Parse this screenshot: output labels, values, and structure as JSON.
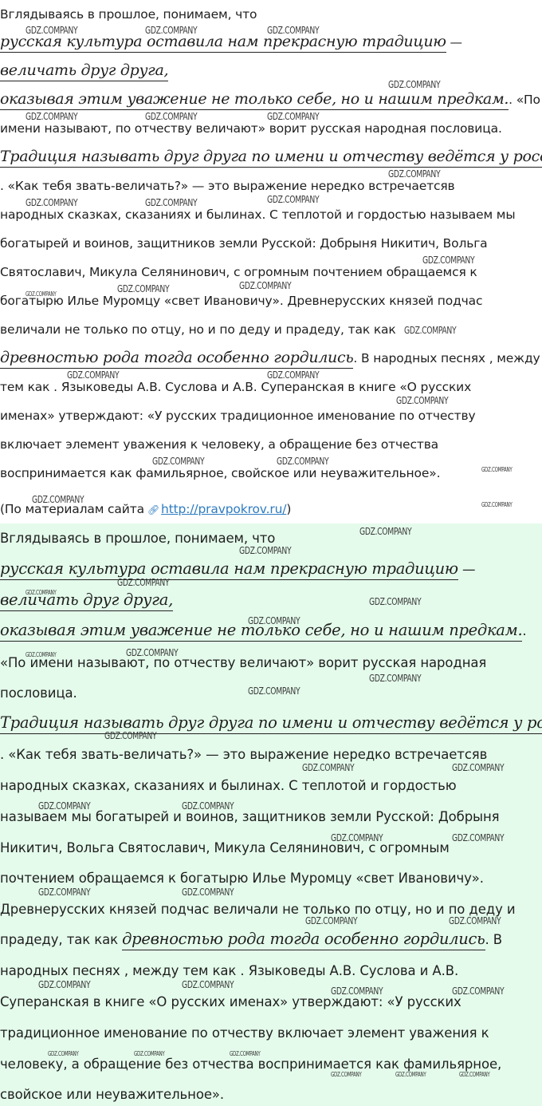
{
  "watermark": "GDZ.COMPANY",
  "link_icon": "link-icon",
  "top": {
    "l1": "Вглядываясь в прошлое, понимаем, что",
    "l2_hl": "русская культура оставила нам прекрасную традицию",
    "l2_tail": " —",
    "l3_hl": "величать друг друга,",
    "l4_hl": "оказывая этим уважение не только себе,  но и нашим предкам.",
    "l4_tail": ". «По",
    "l5": "имени называют, по отчеству величают» ворит русская народная пословица.",
    "l6_hl": "Традиция называть друг друга по имени и отчеству ведётся у россиян и",
    "l7": ". «Как тебя звать-величать?» — это выражение нередко встречаетсяв",
    "l8": "народных сказках, сказаниях и былинах. С теплотой и гордостью называем мы",
    "l9": "богатырей и воинов, защитников земли Русской: Добрыня Никитич, Вольга",
    "l10": "Святославич, Микула Селянинович, с огромным почтением обращаемся к",
    "l11": "богатырю Илье Муромцу «свет Ивановичу». Древнерусских князей подчас",
    "l12": "величали не только по отцу, но и по деду и прадеду, так как",
    "l13_hl": "древностью рода тогда особенно гордились",
    "l13_tail": ". В народных песнях , между",
    "l14": "тем как . Языковеды А.В. Суслова и А.В. Суперанская в книге «О русских",
    "l15": "именах» утверждают: «У русских традиционное именование по отчеству",
    "l16": "включает элемент уважения к человеку, а обращение без отчества",
    "l17": "воспринимается как фамильярное, свойское или неуважительное».",
    "src_prefix": "(По материалам сайта",
    "src_link": "http://pravpokrov.ru/",
    "src_suffix": ")"
  },
  "bottom": {
    "l1": "Вглядываясь в прошлое, понимаем, что",
    "l2_hl": "русская культура оставила нам прекрасную традицию",
    "l2_tail": " —",
    "l3_hl": "величать друг друга,",
    "l4_hl": "оказывая этим уважение не только себе,  но и нашим предкам.",
    "l4_tail": ".",
    "l5": "«По имени называют, по отчеству величают» ворит русская народная",
    "l6": "пословица.",
    "l7_hl": "Традиция называть друг друга по имени и отчеству ведётся у россиян",
    "l8": ". «Как тебя звать-величать?» — это выражение нередко встречаетсяв",
    "l9": "народных сказках, сказаниях и былинах. С теплотой и гордостью",
    "l10": "называем мы богатырей и воинов, защитников земли Русской: Добрыня",
    "l11": "Никитич, Вольга Святославич, Микула Селянинович, с огромным",
    "l12": "почтением обращаемся к богатырю Илье Муромцу «свет Ивановичу».",
    "l13": "Древнерусских князей подчас величали не только по отцу, но и по деду и",
    "l14_pre": "прадеду, так как ",
    "l14_hl": "древностью рода тогда особенно гордились",
    "l14_tail": ". В",
    "l15": "народных песнях , между тем как . Языковеды А.В. Суслова и А.В.",
    "l16": "Суперанская в книге «О русских именах» утверждают: «У русских",
    "l17": "традиционное именование по отчеству включает элемент уважения к",
    "l18": "человеку, а обращение без отчества воспринимается как фамильярное,",
    "l19": "свойское или неуважительное»."
  }
}
